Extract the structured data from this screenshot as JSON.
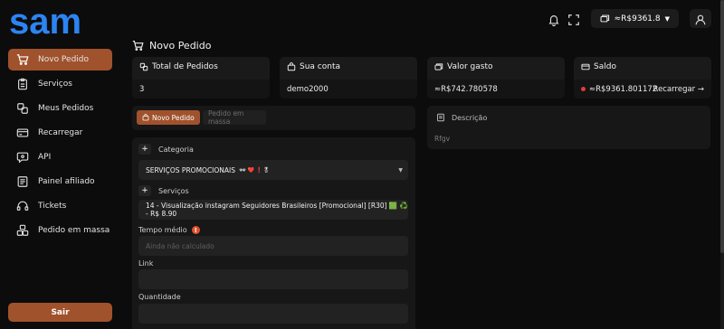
{
  "brand": {
    "logo": "sam",
    "accent": "#a0522d",
    "logo_color": "#2c84f3"
  },
  "sidebar": {
    "items": [
      {
        "label": "Novo Pedido",
        "icon": "cart-icon",
        "active": true
      },
      {
        "label": "Serviços",
        "icon": "clipboard-icon"
      },
      {
        "label": "Meus Pedidos",
        "icon": "orders-icon"
      },
      {
        "label": "Recarregar",
        "icon": "card-icon"
      },
      {
        "label": "API",
        "icon": "api-icon"
      },
      {
        "label": "Painel afiliado",
        "icon": "document-icon"
      },
      {
        "label": "Tickets",
        "icon": "headset-icon"
      },
      {
        "label": "Pedido em massa",
        "icon": "boxes-icon"
      }
    ],
    "logout_label": "Sair"
  },
  "topbar": {
    "balance": "≈R$9361.8",
    "icons": [
      "bell-icon",
      "fullscreen-icon",
      "wallet-icon",
      "user-icon"
    ]
  },
  "page": {
    "title": "Novo Pedido"
  },
  "stats": [
    {
      "label": "Total de Pedidos",
      "value": "3",
      "icon": "orders-icon"
    },
    {
      "label": "Sua conta",
      "value": "demo2000",
      "icon": "bag-icon"
    },
    {
      "label": "Valor gasto",
      "value": "≈R$742.780578",
      "icon": "wallet-icon"
    },
    {
      "label": "Saldo",
      "value": "≈R$9361.801172",
      "icon": "card-icon",
      "action": "Recarregar →"
    }
  ],
  "tabs": {
    "active": "Novo Pedido",
    "inactive": "Pedido em massa"
  },
  "form": {
    "category_label": "Categoria",
    "category_value": "SERVIÇOS PROMOCIONAIS",
    "category_emojis": "🕶 ❤️ ❗🎖",
    "services_label": "Serviços",
    "service_value": "14 - Visualização instagram Seguidores Brasileiros [Promocional] [R30] 🟩 ♻️ - R$ 8.90",
    "avg_time_label": "Tempo médio",
    "avg_time_placeholder": "Ainda não calculado",
    "link_label": "Link",
    "quantity_label": "Quantidade"
  },
  "description": {
    "label": "Descrição",
    "body": "Rfgv"
  }
}
